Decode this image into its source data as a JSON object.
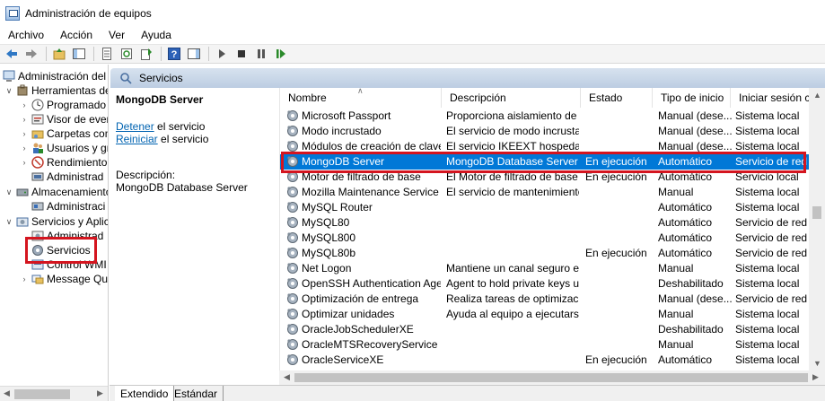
{
  "window": {
    "title": "Administración de equipos"
  },
  "menu": {
    "items": [
      "Archivo",
      "Acción",
      "Ver",
      "Ayuda"
    ]
  },
  "tree": {
    "items": [
      {
        "label": "Administración del e",
        "level": 0,
        "arrow": "",
        "icon": "computer-management-icon"
      },
      {
        "label": "Herramientas de",
        "level": 1,
        "arrow": "v",
        "icon": "tools-icon"
      },
      {
        "label": "Programado",
        "level": 2,
        "arrow": ">",
        "icon": "clock-icon"
      },
      {
        "label": "Visor de ever",
        "level": 2,
        "arrow": ">",
        "icon": "event-viewer-icon"
      },
      {
        "label": "Carpetas com",
        "level": 2,
        "arrow": ">",
        "icon": "shared-folder-icon"
      },
      {
        "label": "Usuarios y gr",
        "level": 2,
        "arrow": ">",
        "icon": "users-icon"
      },
      {
        "label": "Rendimiento",
        "level": 2,
        "arrow": ">",
        "icon": "performance-icon"
      },
      {
        "label": "Administrad",
        "level": 2,
        "arrow": "",
        "icon": "device-manager-icon"
      },
      {
        "label": "Almacenamiento",
        "level": 1,
        "arrow": "v",
        "icon": "storage-icon"
      },
      {
        "label": "Administraci",
        "level": 2,
        "arrow": "",
        "icon": "disk-management-icon"
      },
      {
        "label": "Servicios y Aplic",
        "level": 1,
        "arrow": "v",
        "icon": "services-apps-icon"
      },
      {
        "label": "Administrad",
        "level": 2,
        "arrow": "",
        "icon": "routing-icon"
      },
      {
        "label": "Servicios",
        "level": 2,
        "arrow": "",
        "icon": "gear-icon",
        "selected": true
      },
      {
        "label": "Control WMI",
        "level": 2,
        "arrow": "",
        "icon": "wmi-icon"
      },
      {
        "label": "Message Que",
        "level": 2,
        "arrow": ">",
        "icon": "message-queue-icon"
      }
    ]
  },
  "panel": {
    "header": "Servicios"
  },
  "details": {
    "service_name": "MongoDB Server",
    "stop_link": "Detener",
    "stop_suffix": " el servicio",
    "restart_link": "Reiniciar",
    "restart_suffix": " el servicio",
    "description_label": "Descripción:",
    "description_text": "MongoDB Database Server"
  },
  "list": {
    "columns": [
      "Nombre",
      "Descripción",
      "Estado",
      "Tipo de inicio",
      "Iniciar sesión como"
    ],
    "rows": [
      [
        "Microsoft Passport",
        "Proporciona aislamiento de ...",
        "",
        "Manual (dese...",
        "Sistema local"
      ],
      [
        "Modo incrustado",
        "El servicio de modo incrusta...",
        "",
        "Manual (dese...",
        "Sistema local"
      ],
      [
        "Módulos de creación de claves...",
        "El servicio IKEEXT hospeda lo...",
        "",
        "Manual (dese...",
        "Sistema local"
      ],
      [
        "MongoDB Server",
        "MongoDB Database Server",
        "En ejecución",
        "Automático",
        "Servicio de red"
      ],
      [
        "Motor de filtrado de base",
        "El Motor de filtrado de base (...",
        "En ejecución",
        "Automático",
        "Servicio local"
      ],
      [
        "Mozilla Maintenance Service",
        "El servicio de mantenimiento ...",
        "",
        "Manual",
        "Sistema local"
      ],
      [
        "MySQL Router",
        "",
        "",
        "Automático",
        "Sistema local"
      ],
      [
        "MySQL80",
        "",
        "",
        "Automático",
        "Servicio de red"
      ],
      [
        "MySQL800",
        "",
        "",
        "Automático",
        "Servicio de red"
      ],
      [
        "MySQL80b",
        "",
        "En ejecución",
        "Automático",
        "Servicio de red"
      ],
      [
        "Net Logon",
        "Mantiene un canal seguro e...",
        "",
        "Manual",
        "Sistema local"
      ],
      [
        "OpenSSH Authentication Agent",
        "Agent to hold private keys u...",
        "",
        "Deshabilitado",
        "Sistema local"
      ],
      [
        "Optimización de entrega",
        "Realiza tareas de optimizació...",
        "",
        "Manual (dese...",
        "Servicio de red"
      ],
      [
        "Optimizar unidades",
        "Ayuda al equipo a ejecutarse...",
        "",
        "Manual",
        "Sistema local"
      ],
      [
        "OracleJobSchedulerXE",
        "",
        "",
        "Deshabilitado",
        "Sistema local"
      ],
      [
        "OracleMTSRecoveryService",
        "",
        "",
        "Manual",
        "Sistema local"
      ],
      [
        "OracleServiceXE",
        "",
        "En ejecución",
        "Automático",
        "Sistema local"
      ]
    ],
    "selected_index": 3
  },
  "tabs": {
    "items": [
      "Extendido",
      "Estándar"
    ],
    "active": 0
  },
  "colors": {
    "selection": "#0078d7",
    "highlight": "#d4151f",
    "link": "#0063b1"
  }
}
